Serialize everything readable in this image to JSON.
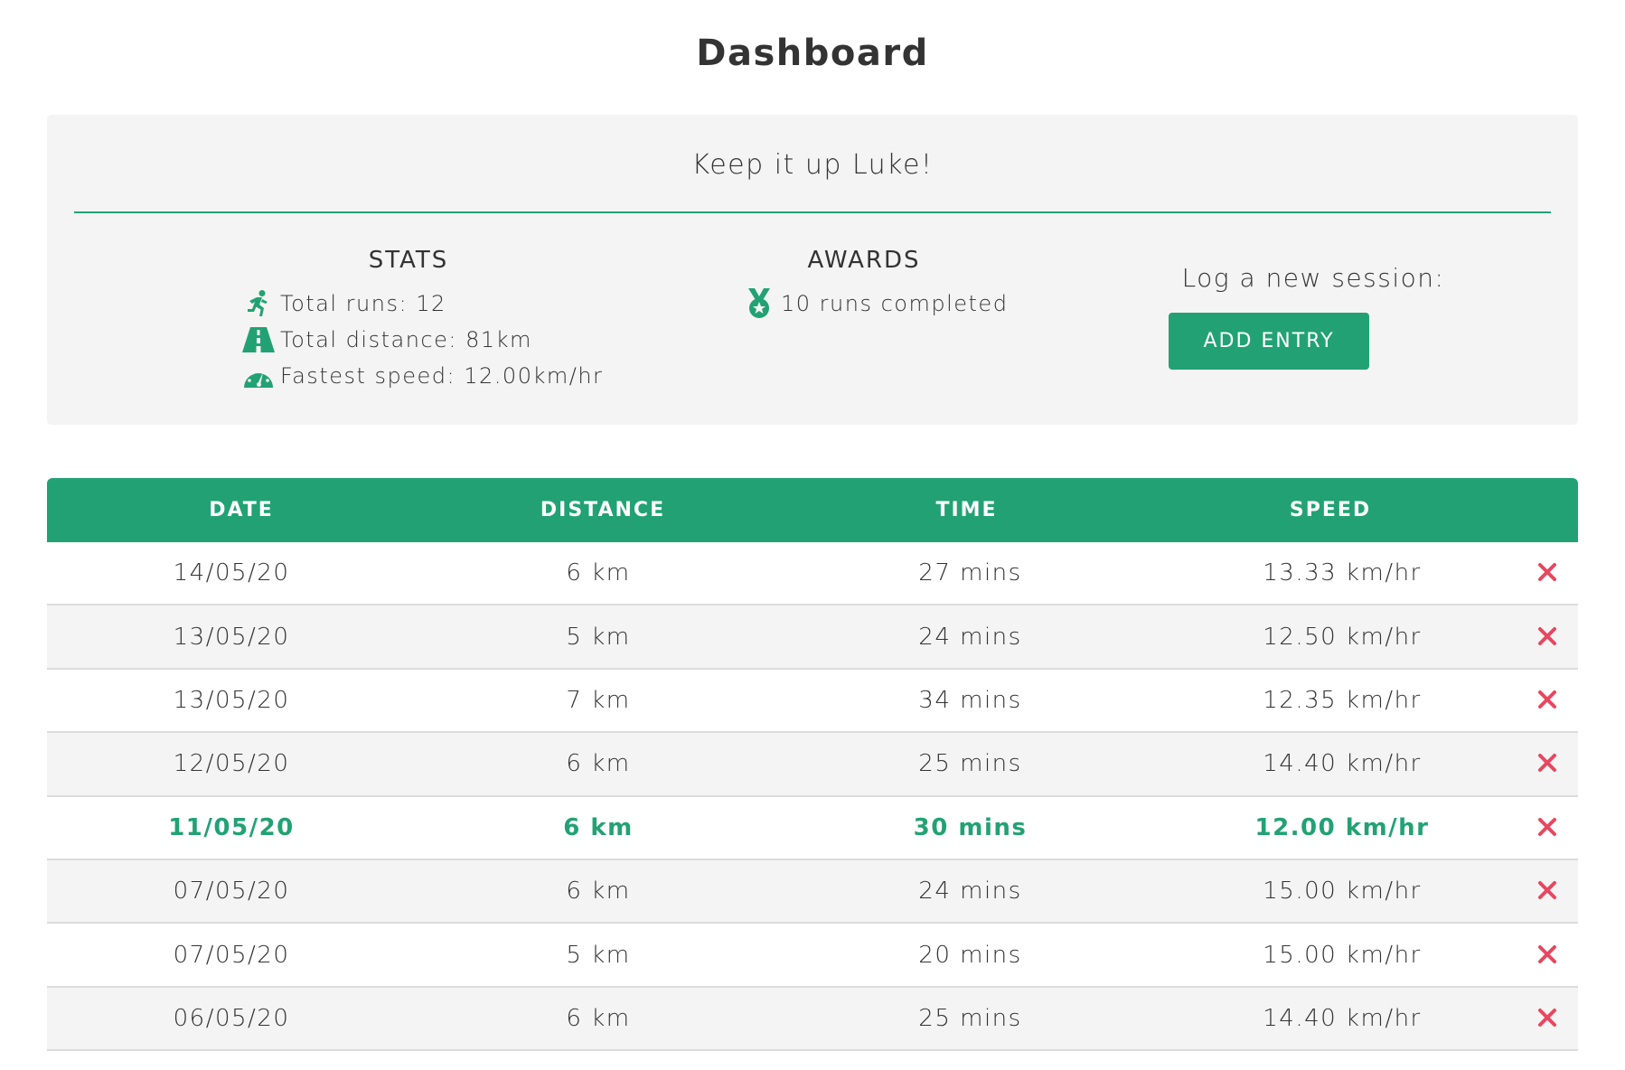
{
  "page": {
    "title": "Dashboard"
  },
  "summary": {
    "greeting": "Keep it up Luke!",
    "stats": {
      "heading": "STATS",
      "total_runs": "Total runs: 12",
      "total_distance": "Total distance: 81km",
      "fastest_speed": "Fastest speed: 12.00km/hr"
    },
    "awards": {
      "heading": "AWARDS",
      "items": [
        "10 runs completed"
      ]
    },
    "log": {
      "label": "Log a new session:",
      "button_label": "ADD ENTRY"
    }
  },
  "colors": {
    "accent": "#22a274",
    "delete": "#e8475f",
    "row_alt": "#f4f4f4"
  },
  "icons": {
    "runs": "running-person-icon",
    "distance": "road-icon",
    "speed": "speedometer-icon",
    "award": "medal-icon",
    "delete": "close-icon"
  },
  "table": {
    "headers": {
      "date": "DATE",
      "distance": "DISTANCE",
      "time": "TIME",
      "speed": "SPEED"
    },
    "rows": [
      {
        "date": "14/05/20",
        "distance": "6 km",
        "time": "27 mins",
        "speed": "13.33 km/hr",
        "highlight": false
      },
      {
        "date": "13/05/20",
        "distance": "5 km",
        "time": "24 mins",
        "speed": "12.50 km/hr",
        "highlight": false
      },
      {
        "date": "13/05/20",
        "distance": "7 km",
        "time": "34 mins",
        "speed": "12.35 km/hr",
        "highlight": false
      },
      {
        "date": "12/05/20",
        "distance": "6 km",
        "time": "25 mins",
        "speed": "14.40 km/hr",
        "highlight": false
      },
      {
        "date": "11/05/20",
        "distance": "6 km",
        "time": "30 mins",
        "speed": "12.00 km/hr",
        "highlight": true
      },
      {
        "date": "07/05/20",
        "distance": "6 km",
        "time": "24 mins",
        "speed": "15.00 km/hr",
        "highlight": false
      },
      {
        "date": "07/05/20",
        "distance": "5 km",
        "time": "20 mins",
        "speed": "15.00 km/hr",
        "highlight": false
      },
      {
        "date": "06/05/20",
        "distance": "6 km",
        "time": "25 mins",
        "speed": "14.40 km/hr",
        "highlight": false
      }
    ]
  }
}
